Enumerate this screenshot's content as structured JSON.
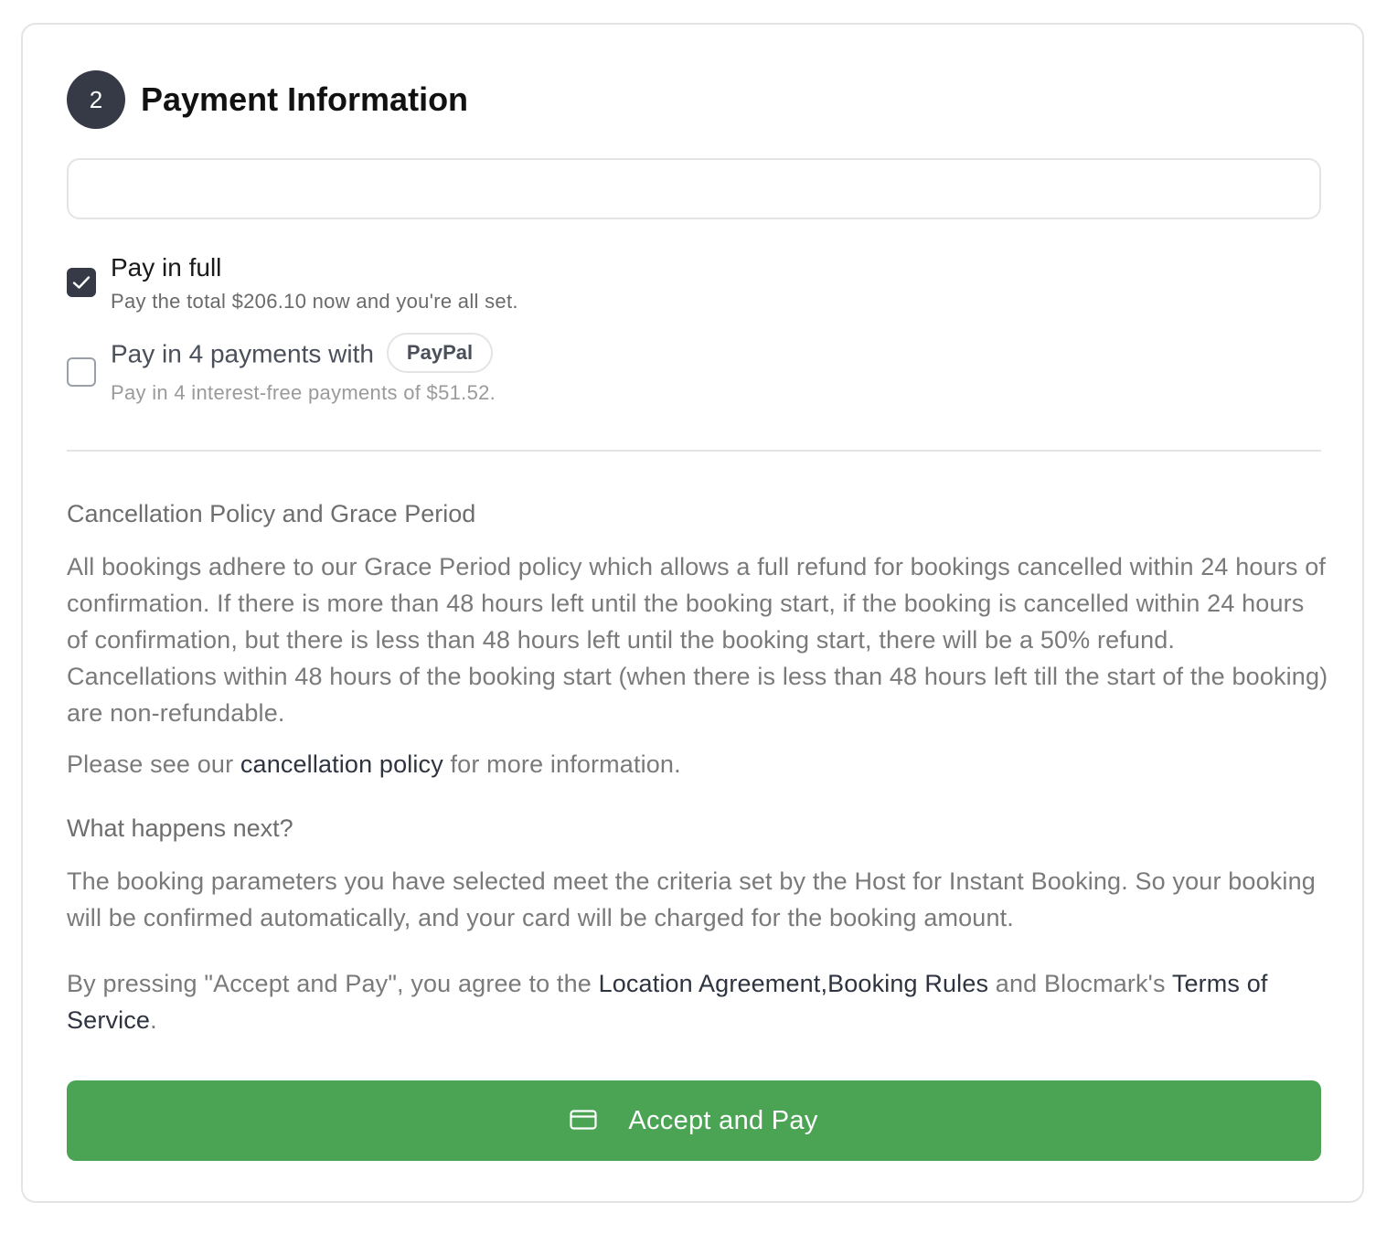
{
  "step": {
    "number": "2",
    "title": "Payment Information"
  },
  "payment_options": [
    {
      "title": "Pay in full",
      "subtitle": "Pay the total $206.10 now and you're all set.",
      "checked": true
    },
    {
      "title": "Pay in 4 payments with",
      "badge": "PayPal",
      "subtitle": "Pay in 4 interest-free payments of $51.52.",
      "checked": false
    }
  ],
  "cancellation": {
    "title": "Cancellation Policy and Grace Period",
    "body": "All bookings adhere to our Grace Period policy which allows a full refund for bookings cancelled within 24 hours of confirmation. If there is more than 48 hours left until the booking start, if the booking is cancelled within 24 hours of confirmation, but there is less than 48 hours left until the booking start, there will be a 50% refund. Cancellations within 48 hours of the booking start (when there is less than 48 hours left till the start of the booking) are non-refundable.",
    "see_prefix": "Please see our ",
    "see_link": "cancellation policy",
    "see_suffix": " for more information."
  },
  "next": {
    "title": "What happens next?",
    "body": "The booking parameters you have selected meet the criteria set by the Host for Instant Booking. So your booking will be confirmed automatically, and your card will be charged for the booking amount."
  },
  "agreement": {
    "prefix": "By pressing \"Accept and Pay\", you agree to the ",
    "link1": "Location Agreement",
    "sep": ",",
    "link2": "Booking Rules",
    "middle": " and Blocmark's ",
    "link3": "Terms of Service",
    "suffix": "."
  },
  "button": {
    "label": "Accept and Pay",
    "icon": "credit-card-icon"
  },
  "colors": {
    "accent_green": "#4ba354",
    "dark": "#353a46",
    "muted_text": "#7a7a7a",
    "border": "#e4e4e7"
  }
}
